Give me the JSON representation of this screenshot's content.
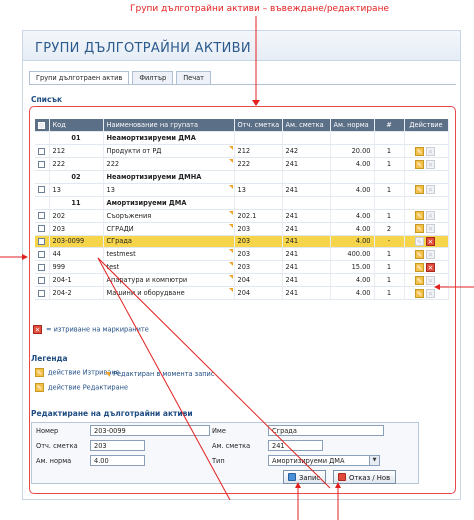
{
  "caption": "Групи дълготрайни активи – въвеждане/редактиране",
  "window_title": "ГРУПИ ДЪЛГОТРАЙНИ АКТИВИ",
  "tabs": [
    {
      "label": "Групи дълготраен актив",
      "active": true
    },
    {
      "label": "Филтър",
      "active": false
    },
    {
      "label": "Печат",
      "active": false
    }
  ],
  "list_section_label": "Списък",
  "table": {
    "headers": [
      "",
      "Код",
      "Наименование на групата",
      "Отч. сметка",
      "Ам. сметка",
      "Ам. норма",
      "#",
      "Действие"
    ],
    "rows": [
      {
        "type": "group",
        "code": "01",
        "name": "Неамортизируеми ДМА"
      },
      {
        "type": "item",
        "code": "212",
        "name": "Продукти от РД",
        "acct": "212",
        "am_acct": "242",
        "rate": "20.00",
        "cnt": "1"
      },
      {
        "type": "item",
        "code": "222",
        "name": "222",
        "acct": "222",
        "am_acct": "241",
        "rate": "4.00",
        "cnt": "1"
      },
      {
        "type": "group",
        "code": "02",
        "name": "Неамортизируеми ДМНА"
      },
      {
        "type": "item",
        "code": "13",
        "name": "13",
        "acct": "13",
        "am_acct": "241",
        "rate": "4.00",
        "cnt": "1"
      },
      {
        "type": "group",
        "code": "11",
        "name": "Амортизируеми ДМА"
      },
      {
        "type": "item",
        "code": "202",
        "name": "Съоръжения",
        "acct": "202.1",
        "am_acct": "241",
        "rate": "4.00",
        "cnt": "1"
      },
      {
        "type": "item",
        "code": "203",
        "name": "СГРАДИ",
        "acct": "203",
        "am_acct": "241",
        "rate": "4.00",
        "cnt": "2"
      },
      {
        "type": "selected",
        "code": "203-0099",
        "name": "СГрада",
        "acct": "203",
        "am_acct": "241",
        "rate": "4.00",
        "cnt": "-"
      },
      {
        "type": "item",
        "code": "44",
        "name": "testmest",
        "acct": "203",
        "am_acct": "241",
        "rate": "400.00",
        "cnt": "1"
      },
      {
        "type": "item",
        "code": "999",
        "name": "test",
        "acct": "203",
        "am_acct": "241",
        "rate": "15.00",
        "cnt": "1"
      },
      {
        "type": "item",
        "code": "204-1",
        "name": "Апаратура и компютри",
        "acct": "204",
        "am_acct": "241",
        "rate": "4.00",
        "cnt": "1"
      },
      {
        "type": "item",
        "code": "204-2",
        "name": "Машини и оборудване",
        "acct": "204",
        "am_acct": "241",
        "rate": "4.00",
        "cnt": "1"
      }
    ],
    "delete_marked_label": "= изтриване на маркираните"
  },
  "legend": {
    "title": "Легенда",
    "items": [
      {
        "icon": "delete-icon",
        "label": "действие Изтриване"
      },
      {
        "icon": "marker-icon",
        "label": "Редактиран в момента запис"
      },
      {
        "icon": "edit-icon",
        "label": "действие Редактиране"
      }
    ]
  },
  "form": {
    "title": "Редактиране на дълготрайни активи",
    "number_label": "Номер",
    "number_value": "203-0099",
    "name_label": "Име",
    "name_value": "Сграда",
    "acct_label": "Отч. сметка",
    "acct_value": "203",
    "am_acct_label": "Ам. сметка",
    "am_acct_value": "241",
    "rate_label": "Ам. норма",
    "rate_value": "4.00",
    "type_label": "Тип",
    "type_value": "Амортизируеми ДМА",
    "save_label": "Запис",
    "cancel_label": "Отказ / Нов"
  },
  "colors": {
    "annotation_red": "#e32020",
    "selected_row": "#f7d54a",
    "header_bg": "#5b6f86",
    "title_blue": "#2b5a8c"
  }
}
